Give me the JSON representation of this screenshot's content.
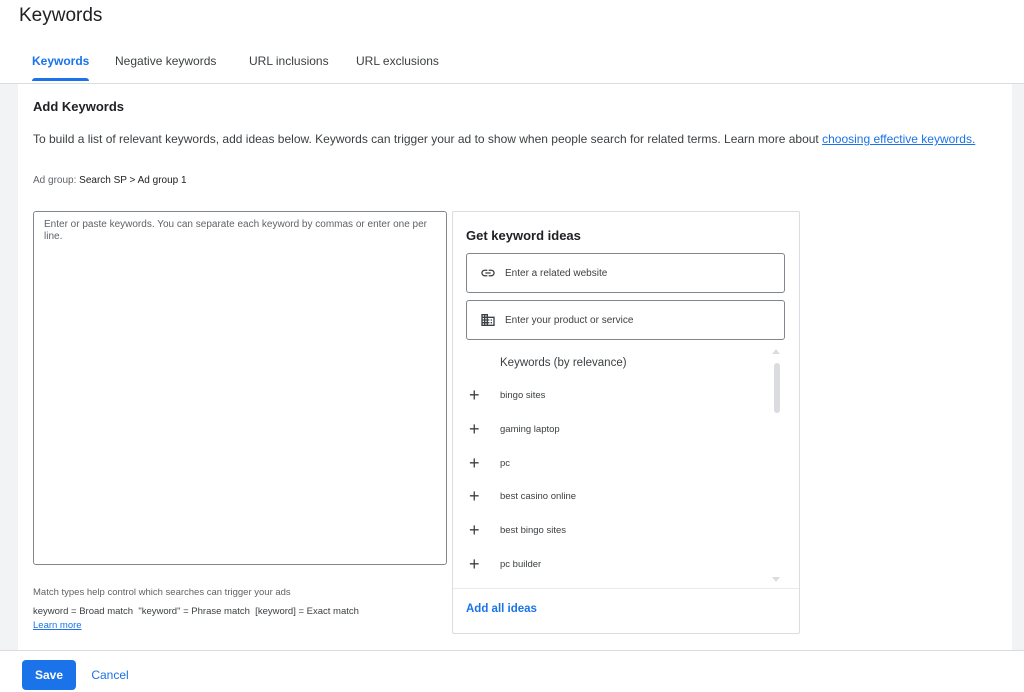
{
  "page": {
    "title": "Keywords"
  },
  "tabs": [
    {
      "label": "Keywords",
      "active": true
    },
    {
      "label": "Negative keywords"
    },
    {
      "label": "URL inclusions"
    },
    {
      "label": "URL exclusions"
    }
  ],
  "add_keywords": {
    "title": "Add Keywords",
    "intro_text": "To build a list of relevant keywords, add ideas below. Keywords can trigger your ad to show when people search for related terms. Learn more about ",
    "intro_link": "choosing effective keywords.",
    "ad_group_label": "Ad group: ",
    "ad_group_value": "Search SP > Ad group 1",
    "textarea_placeholder": "Enter or paste keywords. You can separate each keyword by commas or enter one per line.",
    "textarea_value": "",
    "match_help": "Match types help control which searches can trigger your ads",
    "match_examples": "keyword = Broad match  \"keyword\" = Phrase match  [keyword] = Exact match",
    "learn_more": "Learn more"
  },
  "ideas": {
    "title": "Get keyword ideas",
    "website_placeholder": "Enter a related website",
    "product_placeholder": "Enter your product or service",
    "list_header": "Keywords (by relevance)",
    "items": [
      "bingo sites",
      "gaming laptop",
      "pc",
      "best casino online",
      "best bingo sites",
      "pc builder"
    ],
    "add_all": "Add all ideas",
    "icons": {
      "website": "link-icon",
      "product": "business-icon",
      "add": "plus-icon"
    }
  },
  "footer": {
    "save": "Save",
    "cancel": "Cancel"
  },
  "colors": {
    "accent": "#1a73e8",
    "background": "#f1f3f4",
    "text": "#202124",
    "border": "#dadce0"
  }
}
